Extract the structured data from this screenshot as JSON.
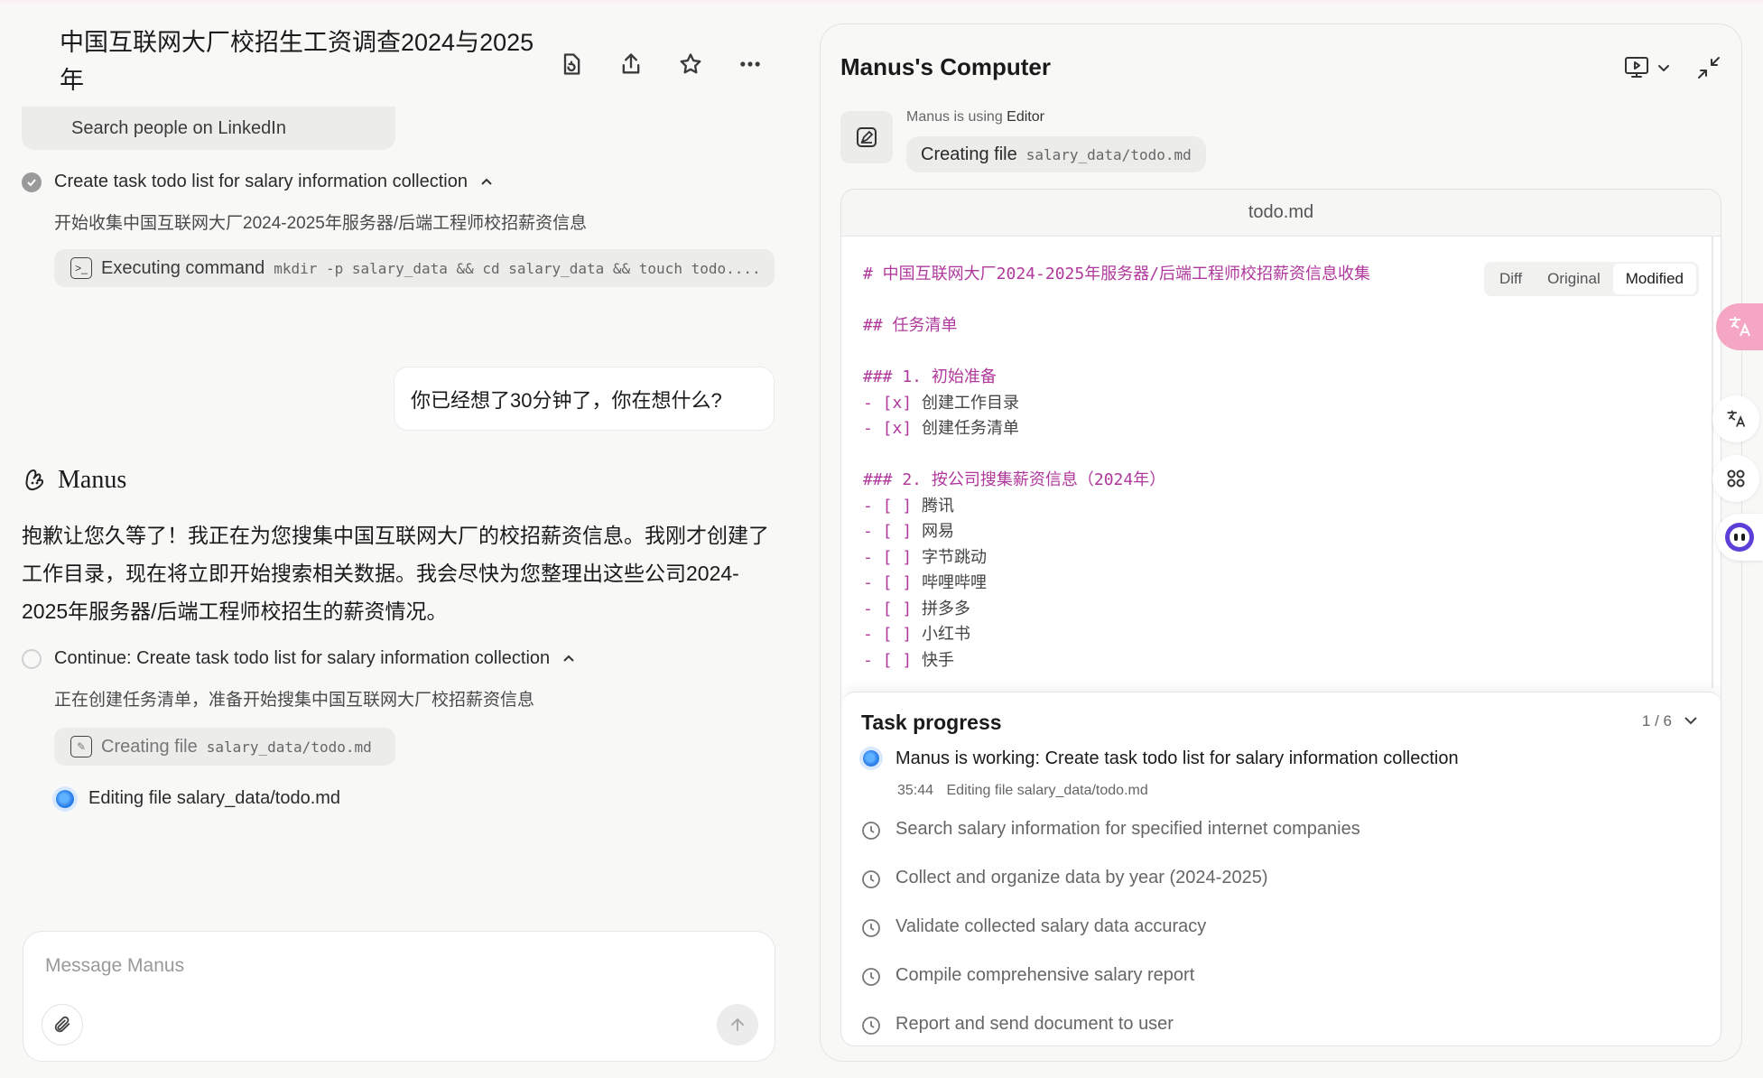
{
  "chat": {
    "title": "中国互联网大厂校招生工资调查2024与2025年",
    "linkedin_pill": "Search people on LinkedIn",
    "step1": {
      "label": "Create task todo list for salary information collection",
      "desc": "开始收集中国互联网大厂2024-2025年服务器/后端工程师校招薪资信息",
      "cmd_label": "Executing command",
      "cmd_text": "mkdir -p salary_data && cd salary_data && touch todo...."
    },
    "user_message": "你已经想了30分钟了，你在想什么?",
    "assistant_name": "Manus",
    "assistant_reply": "抱歉让您久等了！我正在为您搜集中国互联网大厂的校招薪资信息。我刚才创建了工作目录，现在将立即开始搜索相关数据。我会尽快为您整理出这些公司2024-2025年服务器/后端工程师校招生的薪资情况。",
    "step2": {
      "label": "Continue: Create task todo list for salary information collection",
      "desc": "正在创建任务清单，准备开始搜集中国互联网大厂校招薪资信息",
      "file_label": "Creating file",
      "file_path": "salary_data/todo.md",
      "editing": "Editing file salary_data/todo.md"
    },
    "input_placeholder": "Message Manus"
  },
  "computer": {
    "title": "Manus's Computer",
    "using_prefix": "Manus is using",
    "using_tool": "Editor",
    "action_label": "Creating file",
    "action_path": "salary_data/todo.md",
    "file_name": "todo.md",
    "view_tabs": [
      "Diff",
      "Original",
      "Modified"
    ],
    "active_tab": "Modified",
    "code_lines": [
      {
        "cls": "h",
        "text": "# 中国互联网大厂2024-2025年服务器/后端工程师校招薪资信息收集"
      },
      {
        "cls": "t",
        "text": ""
      },
      {
        "cls": "h",
        "text": "## 任务清单"
      },
      {
        "cls": "t",
        "text": ""
      },
      {
        "cls": "h",
        "text": "### 1. 初始准备"
      },
      {
        "cls": "l",
        "mark": "- [x]",
        "text": " 创建工作目录"
      },
      {
        "cls": "l",
        "mark": "- [x]",
        "text": " 创建任务清单"
      },
      {
        "cls": "t",
        "text": ""
      },
      {
        "cls": "h",
        "text": "### 2. 按公司搜集薪资信息（2024年）"
      },
      {
        "cls": "l",
        "mark": "- [ ]",
        "text": " 腾讯"
      },
      {
        "cls": "l",
        "mark": "- [ ]",
        "text": " 网易"
      },
      {
        "cls": "l",
        "mark": "- [ ]",
        "text": " 字节跳动"
      },
      {
        "cls": "l",
        "mark": "- [ ]",
        "text": " 哔哩哔哩"
      },
      {
        "cls": "l",
        "mark": "- [ ]",
        "text": " 拼多多"
      },
      {
        "cls": "l",
        "mark": "- [ ]",
        "text": " 小红书"
      },
      {
        "cls": "l",
        "mark": "- [ ]",
        "text": " 快手"
      }
    ]
  },
  "task_progress": {
    "title": "Task progress",
    "count": "1 / 6",
    "current": "Manus is working: Create task todo list for salary information collection",
    "current_time": "35:44",
    "current_detail": "Editing file salary_data/todo.md",
    "pending": [
      "Search salary information for specified internet companies",
      "Collect and organize data by year (2024-2025)",
      "Validate collected salary data accuracy",
      "Compile comprehensive salary report",
      "Report and send document to user"
    ]
  },
  "colors": {
    "accent_blue": "#2b7de9",
    "markdown_magenta": "#b0389c",
    "translate_pink": "#f5a6c3"
  },
  "side_icons": [
    "translate-icon",
    "translate-small-icon",
    "apps-icon",
    "assistant-face-icon"
  ]
}
